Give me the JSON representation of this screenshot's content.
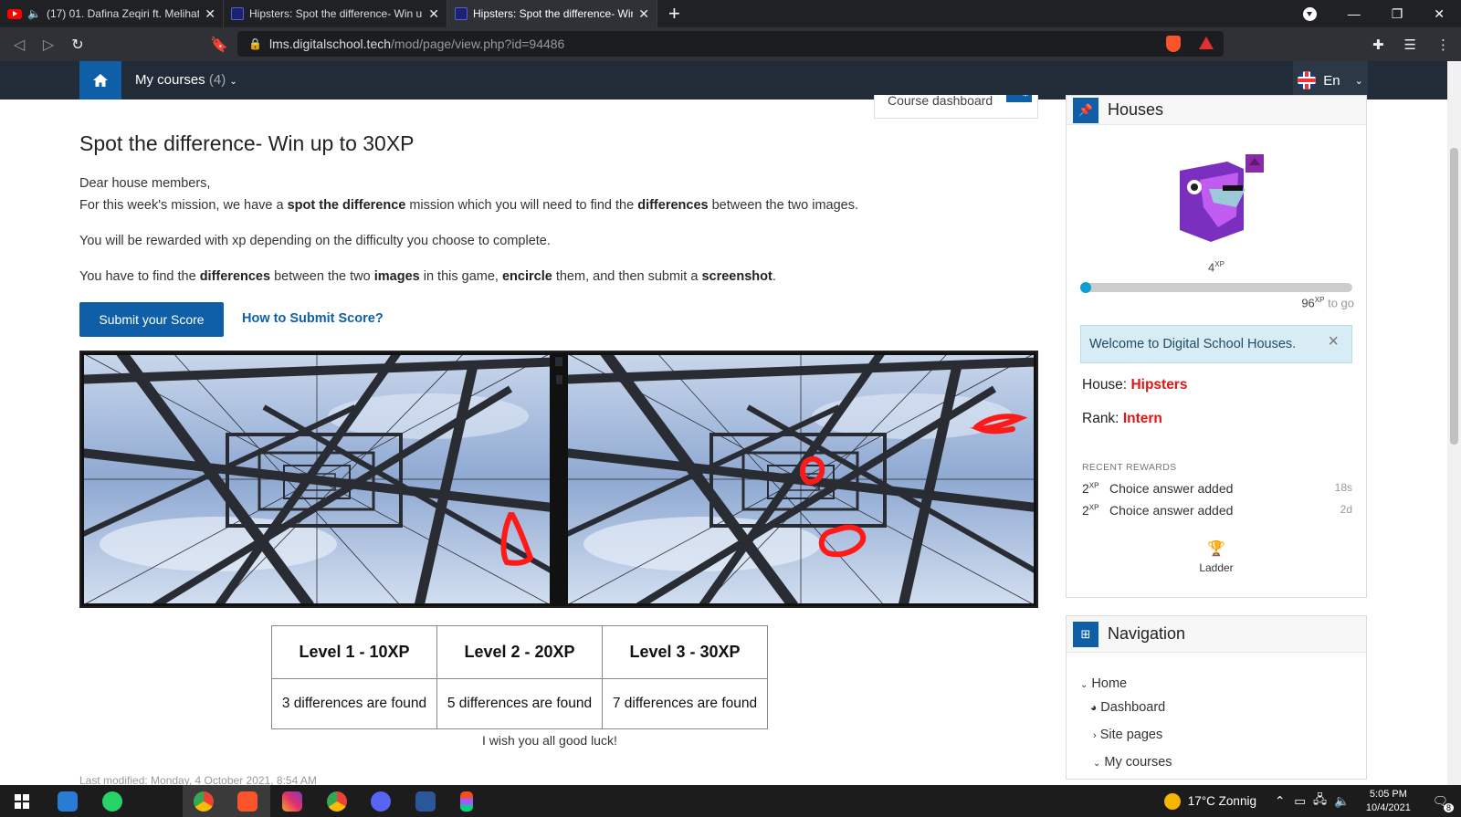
{
  "browser": {
    "tabs": [
      {
        "title": "(17) 01. Dafina Zeqiri ft. Melihat",
        "icon": "youtube-icon"
      },
      {
        "title": "Hipsters: Spot the difference- Win up t",
        "icon": "site-icon"
      },
      {
        "title": "Hipsters: Spot the difference- Win",
        "icon": "site-icon"
      }
    ],
    "url_host": "lms.digitalschool.tech",
    "url_path": "/mod/page/view.php?id=94486"
  },
  "navbar": {
    "my_courses": "My courses",
    "my_courses_count": "(4)",
    "lang": "En"
  },
  "course_dashboard": "Course dashboard",
  "page": {
    "title": "Spot the difference- Win up to 30XP",
    "greeting": "Dear house members,",
    "p1": [
      "For this week's mission, we have a ",
      "spot the difference",
      " mission which you will need to find the ",
      "differences",
      " between the two images."
    ],
    "p2": "You will be rewarded with xp depending on the difficulty you choose to complete.",
    "p3": [
      "You have to find the ",
      "differences",
      " between the two ",
      "images",
      " in this game, ",
      "encircle",
      " them, and then submit a ",
      "screenshot",
      "."
    ],
    "submit_label": "Submit your Score",
    "howto_label": "How to Submit Score?",
    "levels": {
      "headers": [
        "Level 1 - 10XP",
        "Level 2 - 20XP",
        "Level 3 - 30XP"
      ],
      "cells": [
        "3 differences are found",
        "5 differences are found",
        "7 differences are found"
      ]
    },
    "good_luck": "I wish you all good luck!",
    "last_modified": "Last modified: Monday, 4 October 2021, 8:54 AM"
  },
  "houses": {
    "title": "Houses",
    "xp_current": "4",
    "xp_sup": "XP",
    "xp_remaining": "96",
    "to_go": "to go",
    "progress_fraction": 0.04,
    "welcome": "Welcome to Digital School Houses.",
    "house_label": "House:",
    "house_value": "Hipsters",
    "rank_label": "Rank:",
    "rank_value": "Intern",
    "recent_rewards": "RECENT REWARDS",
    "rewards": [
      {
        "xp": "2",
        "text": "Choice answer added",
        "ago": "18s"
      },
      {
        "xp": "2",
        "text": "Choice answer added",
        "ago": "2d"
      }
    ],
    "ladder": "Ladder"
  },
  "navigation": {
    "title": "Navigation",
    "items": [
      "Home",
      "Dashboard",
      "Site pages",
      "My courses"
    ]
  },
  "taskbar": {
    "weather": "17°C  Zonnig",
    "time": "5:05 PM",
    "date": "10/4/2021",
    "notifications": "8"
  }
}
